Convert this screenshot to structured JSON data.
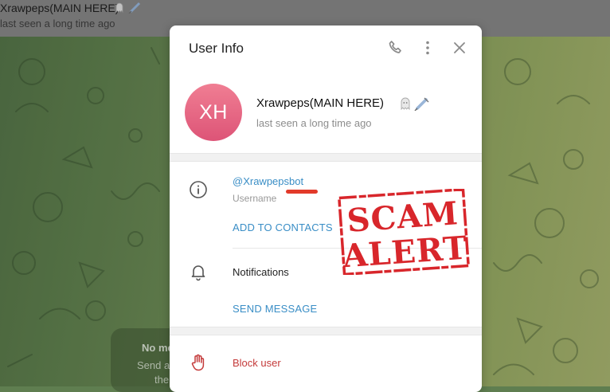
{
  "chat": {
    "title": "Xrawpeps(MAIN HERE)",
    "status": "last seen a long time ago",
    "empty_title": "No me",
    "empty_line1": "Send a",
    "empty_line2": "the"
  },
  "dialog": {
    "title": "User Info",
    "header_icons": [
      "phone-icon",
      "more-vertical-icon",
      "close-icon"
    ]
  },
  "profile": {
    "initials": "XH",
    "name": "Xrawpeps(MAIN HERE)",
    "status": "last seen a long time ago",
    "emoji": [
      "ghost-emoji",
      "syringe-emoji"
    ],
    "avatar_colors": [
      "#f07e93",
      "#dd5477"
    ]
  },
  "info": {
    "username": "@Xrawpepsbot",
    "username_label": "Username",
    "add_to_contacts": "ADD TO CONTACTS",
    "notifications_label": "Notifications",
    "send_message": "SEND MESSAGE",
    "block_user": "Block user"
  },
  "stamp": {
    "line1": "SCAM",
    "line2": "ALERT",
    "color": "#d8262b"
  },
  "colors": {
    "link": "#3a8ec6",
    "danger": "#c43a3a"
  }
}
